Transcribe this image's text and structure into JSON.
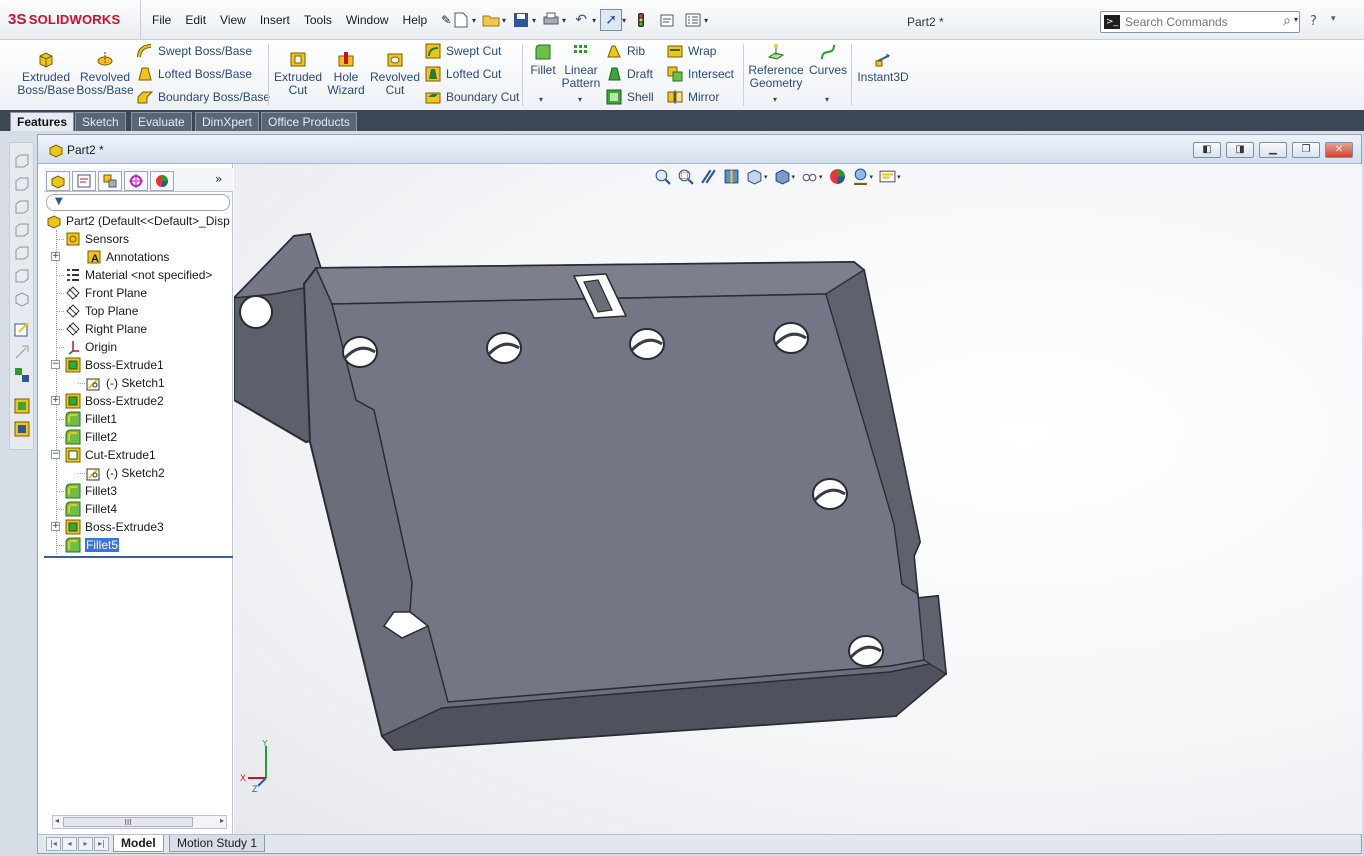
{
  "app": {
    "logo_ds": "3S",
    "logo_solid": "SOLID",
    "logo_works": "WORKS",
    "doc_title": "Part2 *",
    "menus": [
      "File",
      "Edit",
      "View",
      "Insert",
      "Tools",
      "Window",
      "Help"
    ]
  },
  "search": {
    "placeholder": "Search Commands"
  },
  "ribbon": {
    "extruded_boss": [
      "Extruded",
      "Boss/Base"
    ],
    "revolved_boss": [
      "Revolved",
      "Boss/Base"
    ],
    "swept_boss": "Swept Boss/Base",
    "lofted_boss": "Lofted Boss/Base",
    "boundary_boss": "Boundary Boss/Base",
    "extruded_cut": [
      "Extruded",
      "Cut"
    ],
    "hole_wizard": [
      "Hole",
      "Wizard"
    ],
    "revolved_cut": [
      "Revolved",
      "Cut"
    ],
    "swept_cut": "Swept Cut",
    "lofted_cut": "Lofted Cut",
    "boundary_cut": "Boundary Cut",
    "fillet": "Fillet",
    "linear_pattern": [
      "Linear",
      "Pattern"
    ],
    "rib": "Rib",
    "draft": "Draft",
    "shell": "Shell",
    "wrap": "Wrap",
    "intersect": "Intersect",
    "mirror": "Mirror",
    "reference_geometry": [
      "Reference",
      "Geometry"
    ],
    "curves": "Curves",
    "instant3d": "Instant3D"
  },
  "tabs": [
    "Features",
    "Sketch",
    "Evaluate",
    "DimXpert",
    "Office Products"
  ],
  "document": {
    "title": "Part2 *"
  },
  "tree": {
    "root": "Part2  (Default<<Default>_Disp",
    "items": [
      {
        "label": "Sensors",
        "icon": "sensors-icon"
      },
      {
        "label": "Annotations",
        "icon": "annotations-icon"
      },
      {
        "label": "Material <not specified>",
        "icon": "material-icon"
      },
      {
        "label": "Front Plane",
        "icon": "plane-icon"
      },
      {
        "label": "Top Plane",
        "icon": "plane-icon"
      },
      {
        "label": "Right Plane",
        "icon": "plane-icon"
      },
      {
        "label": "Origin",
        "icon": "origin-icon"
      },
      {
        "label": "Boss-Extrude1",
        "icon": "boss-extrude-icon"
      },
      {
        "label": "(-) Sketch1",
        "icon": "sketch-icon"
      },
      {
        "label": "Boss-Extrude2",
        "icon": "boss-extrude-icon"
      },
      {
        "label": "Fillet1",
        "icon": "fillet-icon"
      },
      {
        "label": "Fillet2",
        "icon": "fillet-icon"
      },
      {
        "label": "Cut-Extrude1",
        "icon": "cut-extrude-icon"
      },
      {
        "label": "(-) Sketch2",
        "icon": "sketch-icon"
      },
      {
        "label": "Fillet3",
        "icon": "fillet-icon"
      },
      {
        "label": "Fillet4",
        "icon": "fillet-icon"
      },
      {
        "label": "Boss-Extrude3",
        "icon": "boss-extrude-icon"
      },
      {
        "label": "Fillet5",
        "icon": "fillet-icon",
        "selected": true
      }
    ]
  },
  "triad": {
    "x": "X",
    "y": "Y",
    "z": "Z"
  },
  "bottom_tabs": [
    "Model",
    "Motion Study 1"
  ],
  "colors": {
    "model_face": "#6d717e",
    "model_edge": "#2a2c33",
    "accent": "#c8102e",
    "selection": "#3a73d9"
  }
}
